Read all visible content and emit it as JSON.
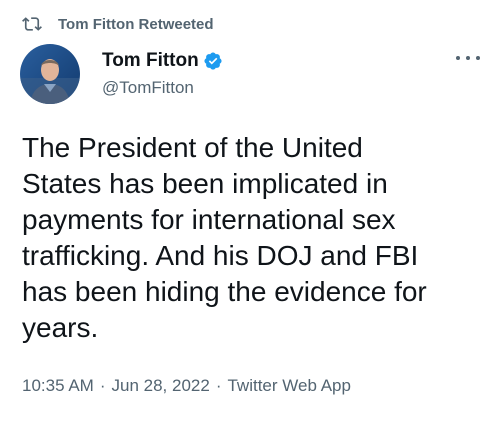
{
  "retweet": {
    "label": "Tom Fitton Retweeted",
    "icon": "retweet-icon"
  },
  "author": {
    "name": "Tom Fitton",
    "handle": "@TomFitton",
    "verified": true,
    "verified_color": "#1d9bf0"
  },
  "tweet": {
    "lines": [
      "The President of the United",
      "States has been implicated in",
      "payments for international sex",
      "trafficking. And his DOJ and FBI",
      "has been hiding the evidence for",
      "years."
    ]
  },
  "meta": {
    "time": "10:35 AM",
    "separator": "·",
    "date": "Jun 28, 2022",
    "source": "Twitter Web App"
  }
}
